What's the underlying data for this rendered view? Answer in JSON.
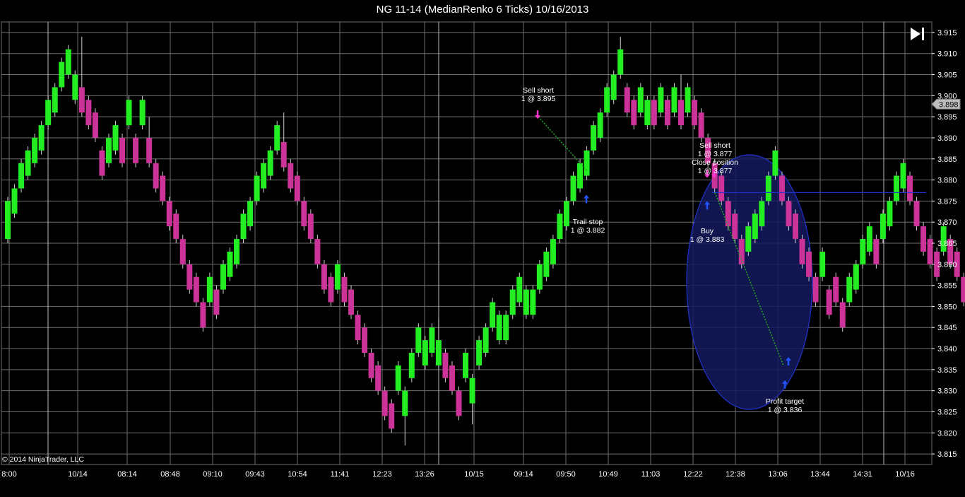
{
  "window": {
    "title": "NG 11-14 (MedianRenko 6 Ticks)  10/16/2013"
  },
  "copyright": "© 2014 NinjaTrader, LLC",
  "controls": {
    "scroll_to_end_icon": "skip-to-end-icon"
  },
  "colors": {
    "up": "#22ee22",
    "down": "#cc3399",
    "grid": "#6f6f6f",
    "background": "#000000",
    "stop_line": "#22aa22",
    "position_line": "#2233cc",
    "ellipse_fill": "#141a5e",
    "ellipse_stroke": "#2233cc",
    "sell_marker": "#ff33cc",
    "buy_marker": "#2255ff"
  },
  "chart_data": {
    "type": "candlestick",
    "title": "NG 11-14 (MedianRenko 6 Ticks)  10/16/2013",
    "ylim": [
      3.8125,
      3.9175
    ],
    "y_ticks": [
      "3.915",
      "3.910",
      "3.905",
      "3.900",
      "3.895",
      "3.890",
      "3.885",
      "3.880",
      "3.875",
      "3.870",
      "3.865",
      "3.860",
      "3.855",
      "3.850",
      "3.845",
      "3.840",
      "3.835",
      "3.830",
      "3.825",
      "3.820",
      "3.815"
    ],
    "current_price": "3.898",
    "x_labels": [
      "8:00",
      "10/14",
      "08:14",
      "08:48",
      "09:10",
      "09:43",
      "10:54",
      "11:41",
      "12:23",
      "13:26",
      "10/15",
      "09:14",
      "09:50",
      "10:49",
      "11:03",
      "12:22",
      "12:38",
      "13:06",
      "13:44",
      "14:31",
      "10/16"
    ],
    "session_breaks": [
      "10/14",
      "10/15",
      "10/16"
    ],
    "bars": [
      [
        3.866,
        3.875,
        3.865,
        3.876
      ],
      [
        3.872,
        3.878,
        3.871,
        3.879
      ],
      [
        3.878,
        3.884,
        3.877,
        3.885
      ],
      [
        3.881,
        3.887,
        3.88,
        3.888
      ],
      [
        3.884,
        3.89,
        3.883,
        3.891
      ],
      [
        3.887,
        3.893,
        3.886,
        3.894
      ],
      [
        3.893,
        3.899,
        3.892,
        3.9
      ],
      [
        3.896,
        3.902,
        3.895,
        3.903
      ],
      [
        3.902,
        3.908,
        3.901,
        3.909
      ],
      [
        3.905,
        3.911,
        3.904,
        3.912
      ],
      [
        3.899,
        3.905,
        3.898,
        3.906
      ],
      [
        3.902,
        3.896,
        3.895,
        3.914
      ],
      [
        3.899,
        3.893,
        3.892,
        3.9
      ],
      [
        3.896,
        3.89,
        3.889,
        3.897
      ],
      [
        3.887,
        3.881,
        3.88,
        3.888
      ],
      [
        3.884,
        3.89,
        3.883,
        3.891
      ],
      [
        3.887,
        3.893,
        3.886,
        3.894
      ],
      [
        3.89,
        3.884,
        3.883,
        3.891
      ],
      [
        3.893,
        3.899,
        3.892,
        3.9
      ],
      [
        3.89,
        3.884,
        3.883,
        3.891
      ],
      [
        3.893,
        3.899,
        3.892,
        3.9
      ],
      [
        3.89,
        3.884,
        3.883,
        3.895
      ],
      [
        3.884,
        3.878,
        3.877,
        3.885
      ],
      [
        3.881,
        3.875,
        3.874,
        3.882
      ],
      [
        3.875,
        3.869,
        3.868,
        3.876
      ],
      [
        3.872,
        3.866,
        3.865,
        3.873
      ],
      [
        3.866,
        3.86,
        3.859,
        3.867
      ],
      [
        3.86,
        3.854,
        3.853,
        3.861
      ],
      [
        3.857,
        3.851,
        3.85,
        3.858
      ],
      [
        3.851,
        3.845,
        3.844,
        3.852
      ],
      [
        3.851,
        3.857,
        3.85,
        3.858
      ],
      [
        3.854,
        3.848,
        3.847,
        3.855
      ],
      [
        3.854,
        3.86,
        3.853,
        3.861
      ],
      [
        3.857,
        3.863,
        3.856,
        3.864
      ],
      [
        3.86,
        3.866,
        3.859,
        3.867
      ],
      [
        3.866,
        3.872,
        3.865,
        3.873
      ],
      [
        3.869,
        3.875,
        3.868,
        3.876
      ],
      [
        3.875,
        3.881,
        3.874,
        3.882
      ],
      [
        3.878,
        3.884,
        3.877,
        3.885
      ],
      [
        3.881,
        3.887,
        3.88,
        3.888
      ],
      [
        3.887,
        3.893,
        3.886,
        3.894
      ],
      [
        3.889,
        3.883,
        3.882,
        3.896
      ],
      [
        3.884,
        3.878,
        3.877,
        3.885
      ],
      [
        3.881,
        3.875,
        3.874,
        3.882
      ],
      [
        3.875,
        3.869,
        3.868,
        3.876
      ],
      [
        3.872,
        3.866,
        3.865,
        3.873
      ],
      [
        3.866,
        3.86,
        3.859,
        3.867
      ],
      [
        3.86,
        3.854,
        3.853,
        3.861
      ],
      [
        3.857,
        3.851,
        3.85,
        3.858
      ],
      [
        3.854,
        3.86,
        3.853,
        3.861
      ],
      [
        3.857,
        3.851,
        3.85,
        3.858
      ],
      [
        3.854,
        3.848,
        3.847,
        3.855
      ],
      [
        3.848,
        3.842,
        3.841,
        3.849
      ],
      [
        3.845,
        3.839,
        3.838,
        3.846
      ],
      [
        3.839,
        3.833,
        3.832,
        3.84
      ],
      [
        3.836,
        3.83,
        3.829,
        3.837
      ],
      [
        3.83,
        3.824,
        3.823,
        3.831
      ],
      [
        3.827,
        3.821,
        3.82,
        3.828
      ],
      [
        3.83,
        3.836,
        3.829,
        3.837
      ],
      [
        3.824,
        3.83,
        3.817,
        3.831
      ],
      [
        3.833,
        3.839,
        3.832,
        3.84
      ],
      [
        3.839,
        3.845,
        3.838,
        3.846
      ],
      [
        3.836,
        3.842,
        3.835,
        3.843
      ],
      [
        3.839,
        3.845,
        3.838,
        3.846
      ],
      [
        3.836,
        3.842,
        3.835,
        3.847
      ],
      [
        3.839,
        3.833,
        3.832,
        3.84
      ],
      [
        3.836,
        3.83,
        3.829,
        3.837
      ],
      [
        3.83,
        3.824,
        3.823,
        3.831
      ],
      [
        3.833,
        3.839,
        3.832,
        3.84
      ],
      [
        3.827,
        3.833,
        3.822,
        3.834
      ],
      [
        3.836,
        3.842,
        3.835,
        3.843
      ],
      [
        3.839,
        3.845,
        3.838,
        3.846
      ],
      [
        3.845,
        3.851,
        3.844,
        3.852
      ],
      [
        3.842,
        3.848,
        3.841,
        3.849
      ],
      [
        3.842,
        3.848,
        3.841,
        3.849
      ],
      [
        3.848,
        3.854,
        3.847,
        3.855
      ],
      [
        3.851,
        3.857,
        3.85,
        3.858
      ],
      [
        3.848,
        3.854,
        3.847,
        3.855
      ],
      [
        3.848,
        3.854,
        3.847,
        3.855
      ],
      [
        3.854,
        3.86,
        3.853,
        3.861
      ],
      [
        3.857,
        3.863,
        3.856,
        3.864
      ],
      [
        3.86,
        3.866,
        3.859,
        3.867
      ],
      [
        3.866,
        3.872,
        3.865,
        3.873
      ],
      [
        3.869,
        3.875,
        3.868,
        3.876
      ],
      [
        3.875,
        3.881,
        3.874,
        3.882
      ],
      [
        3.878,
        3.884,
        3.877,
        3.885
      ],
      [
        3.881,
        3.887,
        3.88,
        3.888
      ],
      [
        3.887,
        3.893,
        3.886,
        3.894
      ],
      [
        3.89,
        3.896,
        3.889,
        3.897
      ],
      [
        3.896,
        3.902,
        3.895,
        3.903
      ],
      [
        3.899,
        3.905,
        3.898,
        3.906
      ],
      [
        3.905,
        3.911,
        3.904,
        3.914
      ],
      [
        3.902,
        3.896,
        3.895,
        3.903
      ],
      [
        3.899,
        3.893,
        3.892,
        3.9
      ],
      [
        3.896,
        3.902,
        3.895,
        3.903
      ],
      [
        3.893,
        3.899,
        3.892,
        3.9
      ],
      [
        3.899,
        3.893,
        3.892,
        3.9
      ],
      [
        3.896,
        3.902,
        3.895,
        3.903
      ],
      [
        3.899,
        3.893,
        3.892,
        3.9
      ],
      [
        3.896,
        3.902,
        3.895,
        3.903
      ],
      [
        3.899,
        3.893,
        3.892,
        3.905
      ],
      [
        3.896,
        3.902,
        3.895,
        3.903
      ],
      [
        3.899,
        3.893,
        3.892,
        3.9
      ],
      [
        3.896,
        3.89,
        3.889,
        3.897
      ],
      [
        3.89,
        3.884,
        3.883,
        3.891
      ],
      [
        3.884,
        3.878,
        3.877,
        3.885
      ],
      [
        3.881,
        3.875,
        3.874,
        3.882
      ],
      [
        3.875,
        3.869,
        3.868,
        3.876
      ],
      [
        3.872,
        3.866,
        3.865,
        3.873
      ],
      [
        3.866,
        3.86,
        3.859,
        3.867
      ],
      [
        3.863,
        3.869,
        3.862,
        3.87
      ],
      [
        3.866,
        3.872,
        3.865,
        3.873
      ],
      [
        3.869,
        3.875,
        3.868,
        3.876
      ],
      [
        3.875,
        3.881,
        3.874,
        3.882
      ],
      [
        3.881,
        3.887,
        3.88,
        3.888
      ],
      [
        3.881,
        3.875,
        3.874,
        3.882
      ],
      [
        3.875,
        3.869,
        3.868,
        3.876
      ],
      [
        3.872,
        3.866,
        3.865,
        3.873
      ],
      [
        3.866,
        3.86,
        3.859,
        3.867
      ],
      [
        3.863,
        3.857,
        3.856,
        3.864
      ],
      [
        3.857,
        3.851,
        3.85,
        3.858
      ],
      [
        3.857,
        3.863,
        3.856,
        3.864
      ],
      [
        3.854,
        3.848,
        3.847,
        3.855
      ],
      [
        3.857,
        3.851,
        3.85,
        3.858
      ],
      [
        3.851,
        3.845,
        3.844,
        3.852
      ],
      [
        3.851,
        3.857,
        3.85,
        3.858
      ],
      [
        3.854,
        3.86,
        3.853,
        3.861
      ],
      [
        3.86,
        3.866,
        3.859,
        3.867
      ],
      [
        3.863,
        3.869,
        3.862,
        3.87
      ],
      [
        3.866,
        3.86,
        3.859,
        3.867
      ],
      [
        3.866,
        3.872,
        3.865,
        3.873
      ],
      [
        3.869,
        3.875,
        3.868,
        3.876
      ],
      [
        3.875,
        3.881,
        3.874,
        3.882
      ],
      [
        3.878,
        3.884,
        3.877,
        3.885
      ],
      [
        3.881,
        3.875,
        3.874,
        3.882
      ],
      [
        3.875,
        3.869,
        3.868,
        3.876
      ],
      [
        3.869,
        3.863,
        3.862,
        3.87
      ],
      [
        3.866,
        3.86,
        3.859,
        3.867
      ],
      [
        3.863,
        3.857,
        3.856,
        3.864
      ],
      [
        3.863,
        3.869,
        3.862,
        3.87
      ],
      [
        3.866,
        3.86,
        3.859,
        3.867
      ],
      [
        3.863,
        3.857,
        3.856,
        3.864
      ],
      [
        3.857,
        3.851,
        3.85,
        3.858
      ],
      [
        3.851,
        3.845,
        3.844,
        3.852
      ],
      [
        3.848,
        3.842,
        3.841,
        3.849
      ],
      [
        3.842,
        3.836,
        3.835,
        3.843
      ],
      [
        3.839,
        3.833,
        3.832,
        3.84
      ],
      [
        3.836,
        3.842,
        3.835,
        3.843
      ],
      [
        3.842,
        3.848,
        3.841,
        3.849
      ],
      [
        3.845,
        3.851,
        3.844,
        3.852
      ],
      [
        3.851,
        3.857,
        3.85,
        3.858
      ],
      [
        3.854,
        3.86,
        3.853,
        3.861
      ],
      [
        3.86,
        3.866,
        3.859,
        3.867
      ],
      [
        3.863,
        3.869,
        3.862,
        3.87
      ],
      [
        3.863,
        3.857,
        3.856,
        3.864
      ],
      [
        3.86,
        3.854,
        3.853,
        3.861
      ],
      [
        3.854,
        3.848,
        3.847,
        3.855
      ],
      [
        3.851,
        3.845,
        3.844,
        3.852
      ],
      [
        3.845,
        3.839,
        3.838,
        3.846
      ],
      [
        3.848,
        3.854,
        3.847,
        3.855
      ],
      [
        3.851,
        3.857,
        3.85,
        3.858
      ],
      [
        3.857,
        3.863,
        3.856,
        3.864
      ],
      [
        3.86,
        3.866,
        3.859,
        3.867
      ],
      [
        3.866,
        3.872,
        3.865,
        3.873
      ],
      [
        3.869,
        3.875,
        3.868,
        3.876
      ],
      [
        3.866,
        3.872,
        3.862,
        3.873
      ],
      [
        3.869,
        3.875,
        3.868,
        3.876
      ],
      [
        3.875,
        3.881,
        3.874,
        3.882
      ],
      [
        3.878,
        3.884,
        3.877,
        3.885
      ],
      [
        3.884,
        3.89,
        3.883,
        3.891
      ],
      [
        3.887,
        3.893,
        3.886,
        3.894
      ],
      [
        3.893,
        3.899,
        3.892,
        3.9
      ]
    ],
    "annotations": [
      {
        "label": "Sell short",
        "detail": "1 @ 3.895"
      },
      {
        "label": "Trail stop",
        "detail": "1 @ 3.882"
      },
      {
        "label": "Sell short",
        "detail": "1 @ 3.877"
      },
      {
        "label": "Close position",
        "detail": "1 @ 3.877"
      },
      {
        "label": "Buy",
        "detail": "1 @ 3.883"
      },
      {
        "label": "Profit target",
        "detail": "1 @ 3.836"
      }
    ],
    "position_line_price": 3.877,
    "grid": true
  }
}
